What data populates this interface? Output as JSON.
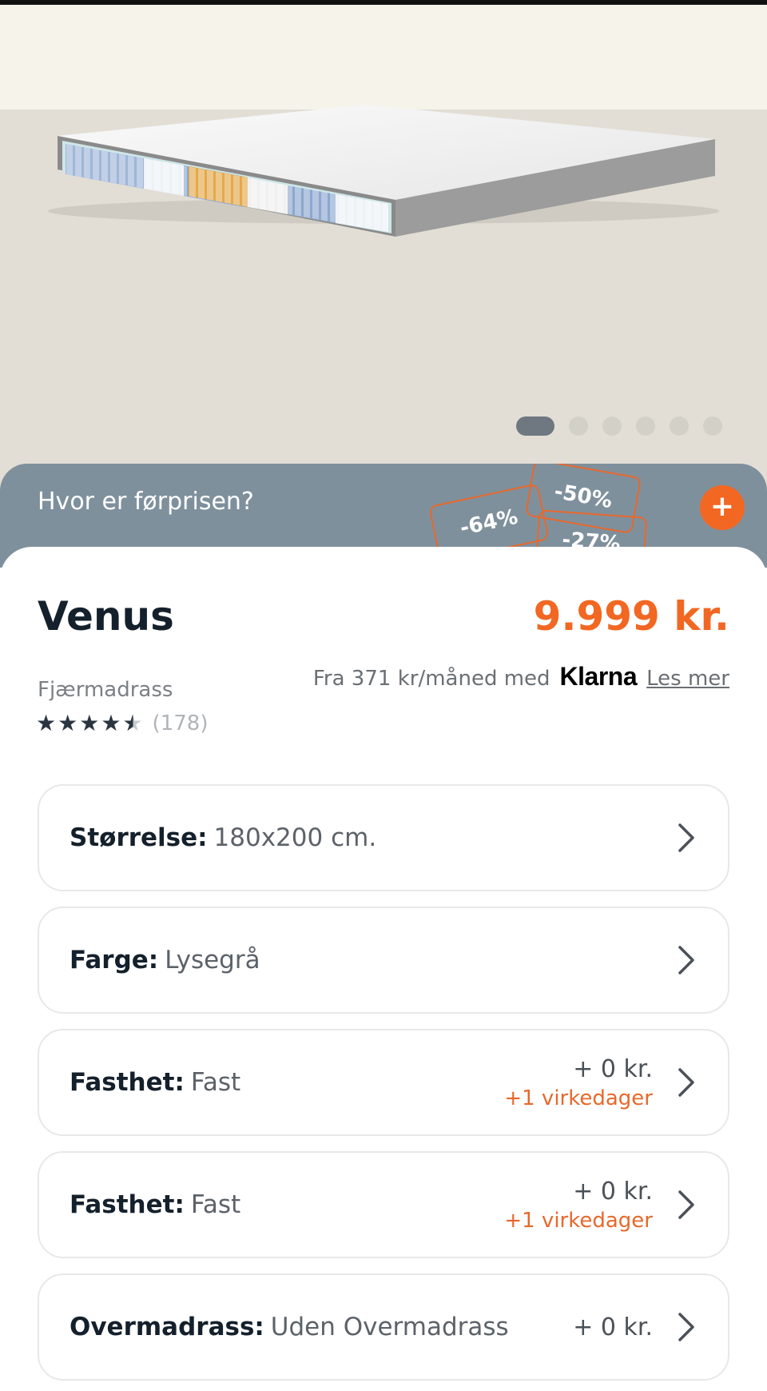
{
  "hero": {
    "image_alt": "Venus fjærmadrass",
    "carousel": {
      "total": 6,
      "active_index": 0
    }
  },
  "promo": {
    "question": "Hvor er førprisen?",
    "tags": [
      "-64%",
      "-50%",
      "-27%"
    ],
    "expand_icon": "plus-icon"
  },
  "product": {
    "name": "Venus",
    "price": "9.999 kr.",
    "finance_text": "Fra 371 kr/måned med",
    "finance_brand": "Klarna",
    "finance_link": "Les mer",
    "category": "Fjærmadrass",
    "rating_value": 4.5,
    "rating_max": 5,
    "rating_count": "(178)"
  },
  "options": [
    {
      "key": "Størrelse:",
      "value": "180x200 cm.",
      "price": "",
      "delivery": ""
    },
    {
      "key": "Farge:",
      "value": "Lysegrå",
      "price": "",
      "delivery": ""
    },
    {
      "key": "Fasthet:",
      "value": "Fast",
      "price": "+ 0 kr.",
      "delivery": "+1 virkedager"
    },
    {
      "key": "Fasthet:",
      "value": "Fast",
      "price": "+ 0 kr.",
      "delivery": "+1 virkedager"
    },
    {
      "key": "Overmadrass:",
      "value": "Uden Overmadrass",
      "price": "+ 0 kr.",
      "delivery": ""
    }
  ],
  "colors": {
    "accent": "#f26722",
    "promo_bg": "#7f909d",
    "text_dark": "#14202b"
  }
}
